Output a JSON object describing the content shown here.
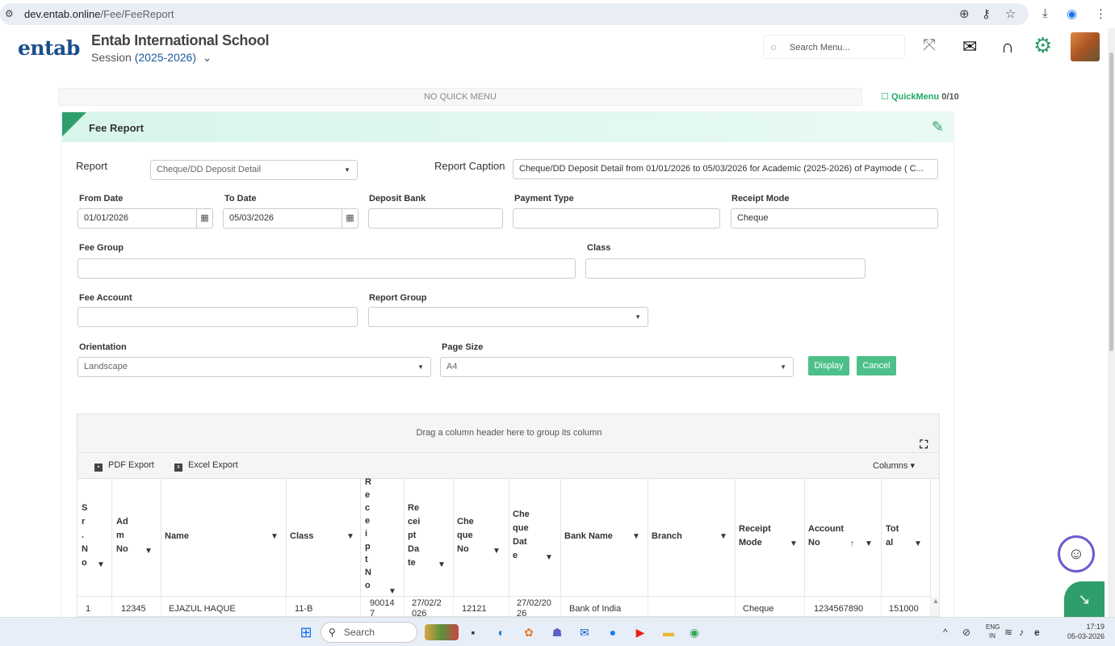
{
  "browser": {
    "url_host": "dev.entab.online",
    "url_path": "/Fee/FeeReport"
  },
  "header": {
    "logo_text": "entab",
    "school_name": "Entab International School",
    "session_label": "Session",
    "session_value": "(2025-2026)",
    "search_placeholder": "Search Menu..."
  },
  "quick_menu": {
    "empty_text": "NO QUICK MENU",
    "link_label": "QuickMenu",
    "count": "0/10"
  },
  "panel": {
    "title": "Fee Report"
  },
  "form": {
    "report_label": "Report",
    "report_value": "Cheque/DD Deposit Detail",
    "caption_label": "Report Caption",
    "caption_value": "Cheque/DD Deposit Detail from 01/01/2026 to 05/03/2026 for Academic (2025-2026)  of Paymode ( C...",
    "from_date_label": "From Date",
    "from_date_value": "01/01/2026",
    "to_date_label": "To Date",
    "to_date_value": "05/03/2026",
    "deposit_bank_label": "Deposit Bank",
    "deposit_bank_value": "",
    "payment_type_label": "Payment Type",
    "payment_type_value": "",
    "receipt_mode_label": "Receipt Mode",
    "receipt_mode_value": "Cheque",
    "fee_group_label": "Fee Group",
    "fee_group_value": "",
    "class_label": "Class",
    "class_value": "",
    "fee_account_label": "Fee Account",
    "fee_account_value": "",
    "report_group_label": "Report Group",
    "report_group_value": "",
    "orientation_label": "Orientation",
    "orientation_value": "Landscape",
    "page_size_label": "Page Size",
    "page_size_value": "A4",
    "display_btn": "Display",
    "cancel_btn": "Cancel"
  },
  "grid": {
    "group_hint": "Drag a column header here to group its column",
    "pdf_export": "PDF Export",
    "excel_export": "Excel Export",
    "columns_menu": "Columns",
    "headers": {
      "srno": "S\nr\n.\nN\no",
      "admno": "Ad\nm\nNo",
      "name": "Name",
      "class": "Class",
      "receiptno": "R\ne\nc\ne\ni\np\nt\nN\no",
      "receiptdate": "Re\ncei\npt\nDa\nte",
      "chequeno": "Che\nque\nNo",
      "chequedate": "Che\nque\nDat\ne",
      "bankname": "Bank Name",
      "branch": "Branch",
      "receiptmode": "Receipt\nMode",
      "accountno": "Account\nNo",
      "total": "Tot\nal"
    },
    "rows": [
      {
        "srno": "1",
        "admno": "12345",
        "name": "EJAZUL HAQUE",
        "class": "11-B",
        "receiptno": "90014\n7",
        "receiptdate": "27/02/2\n026",
        "chequeno": "12121",
        "chequedate": "27/02/20\n26",
        "bankname": "Bank of India",
        "branch": "",
        "receiptmode": "Cheque",
        "accountno": "1234567890",
        "total": "151000"
      }
    ]
  },
  "taskbar": {
    "search_label": "Search",
    "lang_top": "ENG",
    "lang_bottom": "IN",
    "time": "17:19",
    "date": "05-03-2026"
  },
  "colors": {
    "accent_green": "#2e9e6a",
    "button_green": "#4dc08a",
    "brand_blue": "#1a4f8b",
    "chat_ring": "#6d5bd0"
  }
}
